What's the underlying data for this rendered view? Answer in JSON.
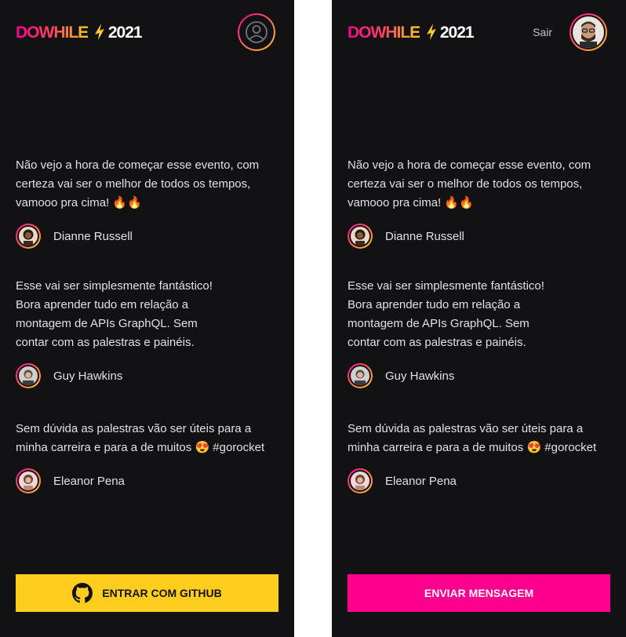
{
  "logo": {
    "part1": "DOWHILE",
    "part2": "2021",
    "spark_icon": "rocket-spark-icon"
  },
  "colors": {
    "background": "#121214",
    "text": "#e1e1e6",
    "pink": "#ff008e",
    "yellow": "#ffcd1e"
  },
  "left_screen": {
    "avatar_icon": "user-placeholder-icon",
    "button_label": "ENTRAR COM GITHUB",
    "button_icon": "github-icon"
  },
  "right_screen": {
    "sign_out_label": "Sair",
    "avatar_icon": "user-avatar-photo",
    "button_label": "ENVIAR MENSAGEM"
  },
  "messages": [
    {
      "text": "Não vejo a hora de começar esse evento, com certeza vai ser o melhor de todos os tempos, vamooo pra cima! 🔥🔥",
      "user": "Dianne Russell"
    },
    {
      "text": "Esse vai ser simplesmente fantástico!\nBora aprender tudo em relação a\nmontagem de APIs GraphQL. Sem\ncontar com as palestras e painéis.",
      "user": "Guy Hawkins"
    },
    {
      "text": "Sem dúvida as palestras vão ser úteis para a minha carreira e para a de muitos 😍 #gorocket",
      "user": "Eleanor Pena"
    }
  ]
}
